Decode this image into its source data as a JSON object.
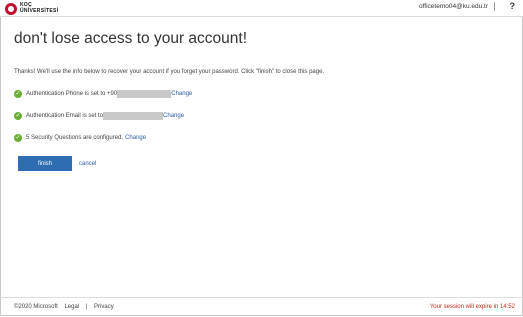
{
  "header": {
    "logo_lines": [
      "KOÇ",
      "ÜNİVERSİTESİ"
    ],
    "user_email": "officetemo04@ku.edu.tr",
    "help_label": "?"
  },
  "main": {
    "title": "don't lose access to your account!",
    "intro": "Thanks! We'll use the info below to recover your account if you forget your password. Click \"finish\" to close this page.",
    "items": [
      {
        "text": "Authentication Phone is set to +90",
        "link": "Change"
      },
      {
        "text": "Authentication Email is set to",
        "link": "Change"
      },
      {
        "text": "5 Security Questions are configured.",
        "link": "Change"
      }
    ],
    "finish_label": "finish",
    "cancel_label": "cancel"
  },
  "footer": {
    "copyright": "©2020 Microsoft",
    "legal": "Legal",
    "sep": "|",
    "privacy": "Privacy",
    "session": "Your session will expire in 14:52"
  },
  "colors": {
    "accent": "#2f6db3",
    "check": "#6aaf33",
    "warning": "#c42b1c"
  }
}
